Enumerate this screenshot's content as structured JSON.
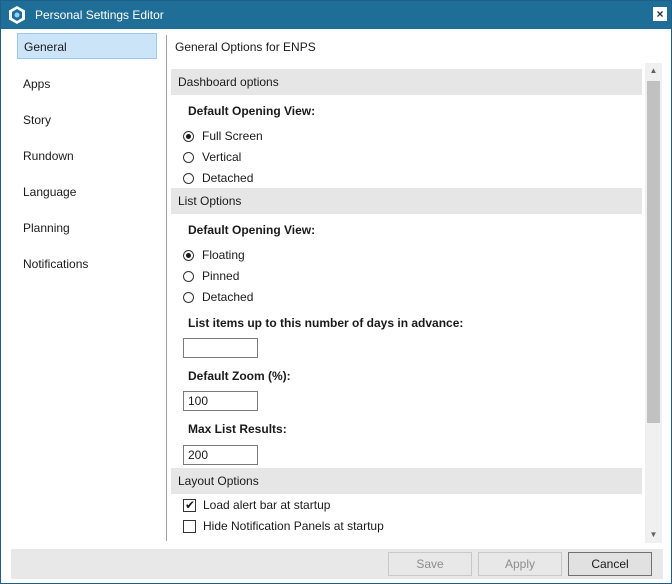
{
  "window": {
    "title": "Personal Settings Editor",
    "close_glyph": "×",
    "app_icon": "enps-hexagon-icon"
  },
  "colors": {
    "titlebar": "#1f6e97",
    "nav_active": "#cce4f7",
    "section_header": "#e6e6e6"
  },
  "sidebar": {
    "items": [
      {
        "label": "General",
        "active": true
      },
      {
        "label": "Apps"
      },
      {
        "label": "Story"
      },
      {
        "label": "Rundown"
      },
      {
        "label": "Language"
      },
      {
        "label": "Planning"
      },
      {
        "label": "Notifications"
      }
    ]
  },
  "content": {
    "title": "General Options for ENPS",
    "dashboard": {
      "header": "Dashboard options",
      "view_label": "Default Opening View:",
      "options": [
        "Full Screen",
        "Vertical",
        "Detached"
      ],
      "selected": "Full Screen"
    },
    "list": {
      "header": "List Options",
      "view_label": "Default Opening View:",
      "options": [
        "Floating",
        "Pinned",
        "Detached"
      ],
      "selected": "Floating",
      "days_label": "List items up to this number of days in advance:",
      "days_value": "",
      "zoom_label": "Default Zoom (%):",
      "zoom_value": "100",
      "max_label": "Max List Results:",
      "max_value": "200"
    },
    "layout": {
      "header": "Layout Options",
      "load_alert_label": "Load alert bar at startup",
      "load_alert_checked": true,
      "hide_notif_label": "Hide Notification Panels at startup",
      "hide_notif_checked": false
    }
  },
  "footer": {
    "save": "Save",
    "apply": "Apply",
    "cancel": "Cancel"
  }
}
